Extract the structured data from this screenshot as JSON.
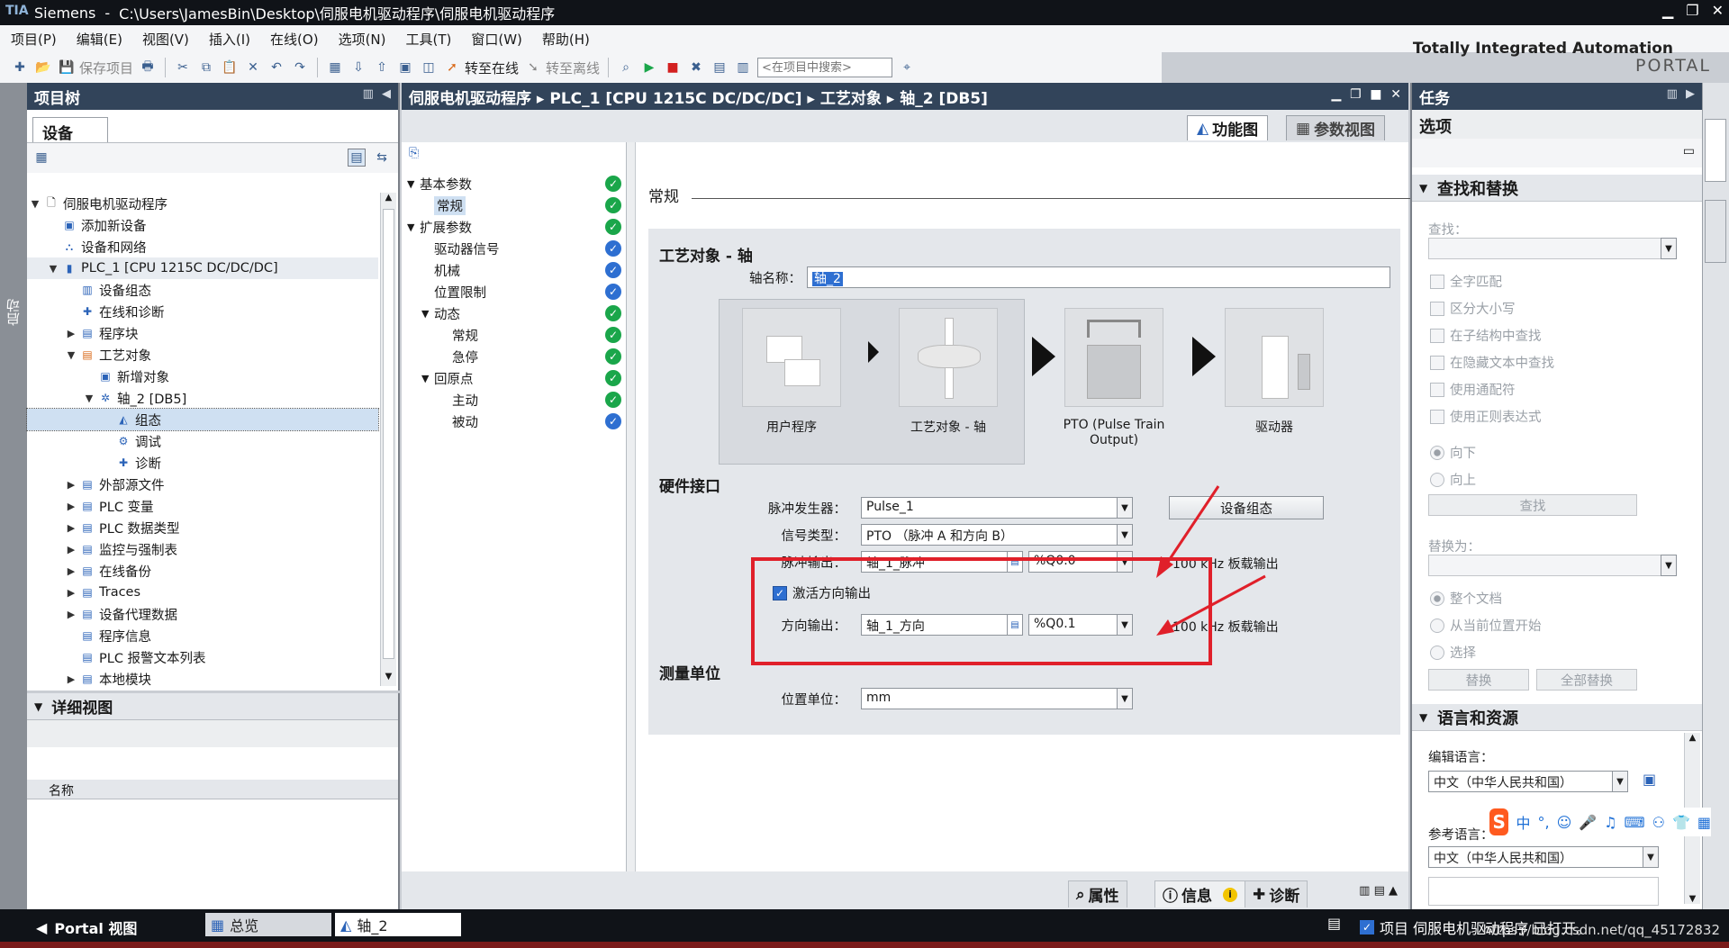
{
  "titlebar": {
    "app": "Siemens",
    "path": "C:\\Users\\JamesBin\\Desktop\\伺服电机驱动程序\\伺服电机驱动程序"
  },
  "menu": [
    "项目(P)",
    "编辑(E)",
    "视图(V)",
    "插入(I)",
    "在线(O)",
    "选项(N)",
    "工具(T)",
    "窗口(W)",
    "帮助(H)"
  ],
  "brand": {
    "line1": "Totally Integrated Automation",
    "line2": "PORTAL"
  },
  "toolbar": {
    "save_project": "保存项目",
    "go_online": "转至在线",
    "go_offline": "转至离线",
    "search_placeholder": "<在项目中搜索>"
  },
  "leftstrip": {
    "label": "启动"
  },
  "project_tree": {
    "title": "项目树",
    "tab": "设备",
    "items": [
      {
        "label": "伺服电机驱动程序",
        "icon": "project-icon"
      },
      {
        "label": "添加新设备",
        "icon": "add-device-icon"
      },
      {
        "label": "设备和网络",
        "icon": "network-icon"
      },
      {
        "label": "PLC_1 [CPU 1215C DC/DC/DC]",
        "icon": "plc-icon"
      },
      {
        "label": "设备组态",
        "icon": "device-config-icon"
      },
      {
        "label": "在线和诊断",
        "icon": "diagnostics-icon"
      },
      {
        "label": "程序块",
        "icon": "program-blocks-icon"
      },
      {
        "label": "工艺对象",
        "icon": "technology-objects-icon"
      },
      {
        "label": "新增对象",
        "icon": "add-object-icon"
      },
      {
        "label": "轴_2 [DB5]",
        "icon": "axis-icon"
      },
      {
        "label": "组态",
        "icon": "configuration-icon"
      },
      {
        "label": "调试",
        "icon": "commissioning-icon"
      },
      {
        "label": "诊断",
        "icon": "diagnostics-icon"
      },
      {
        "label": "外部源文件",
        "icon": "external-source-icon"
      },
      {
        "label": "PLC 变量",
        "icon": "plc-tags-icon"
      },
      {
        "label": "PLC 数据类型",
        "icon": "plc-datatypes-icon"
      },
      {
        "label": "监控与强制表",
        "icon": "watch-table-icon"
      },
      {
        "label": "在线备份",
        "icon": "online-backup-icon"
      },
      {
        "label": "Traces",
        "icon": "traces-icon"
      },
      {
        "label": "设备代理数据",
        "icon": "proxy-data-icon"
      },
      {
        "label": "程序信息",
        "icon": "program-info-icon"
      },
      {
        "label": "PLC 报警文本列表",
        "icon": "alarm-text-icon"
      },
      {
        "label": "本地模块",
        "icon": "local-modules-icon"
      }
    ]
  },
  "detail_view": {
    "title": "详细视图",
    "column": "名称"
  },
  "editor": {
    "breadcrumb": "伺服电机驱动程序 ▸ PLC_1 [CPU 1215C DC/DC/DC] ▸ 工艺对象 ▸ 轴_2 [DB5]",
    "tab_function": "功能图",
    "tab_param": "参数视图",
    "nav": [
      {
        "label": "基本参数",
        "status": "ok"
      },
      {
        "label": "常规",
        "status": "ok"
      },
      {
        "label": "扩展参数",
        "status": "ok"
      },
      {
        "label": "驱动器信号",
        "status": "info"
      },
      {
        "label": "机械",
        "status": "info"
      },
      {
        "label": "位置限制",
        "status": "info"
      },
      {
        "label": "动态",
        "status": "ok"
      },
      {
        "label": "常规",
        "status": "ok"
      },
      {
        "label": "急停",
        "status": "ok"
      },
      {
        "label": "回原点",
        "status": "ok"
      },
      {
        "label": "主动",
        "status": "ok"
      },
      {
        "label": "被动",
        "status": "info"
      }
    ],
    "section_general": "常规",
    "tech_object_title": "工艺对象 - 轴",
    "axis_name_label": "轴名称：",
    "axis_name_value": "轴_2",
    "flow": [
      "用户程序",
      "工艺对象 - 轴",
      "PTO (Pulse Train Output)",
      "驱动器"
    ],
    "hw_title": "硬件接口",
    "pulse_gen_label": "脉冲发生器：",
    "pulse_gen_value": "Pulse_1",
    "device_config_btn": "设备组态",
    "signal_type_label": "信号类型：",
    "signal_type_value": "PTO （脉冲 A 和方向 B）",
    "pulse_out_label": "脉冲输出：",
    "pulse_out_value": "轴_1_脉冲",
    "pulse_out_addr": "%Q0.0",
    "pulse_out_note": "100 kHz 板载输出",
    "enable_dir_label": "激活方向输出",
    "dir_out_label": "方向输出：",
    "dir_out_value": "轴_1_方向",
    "dir_out_addr": "%Q0.1",
    "dir_out_note": "100 kHz 板载输出",
    "unit_title": "测量单位",
    "pos_unit_label": "位置单位：",
    "pos_unit_value": "mm"
  },
  "editor_bottom": {
    "properties": "属性",
    "info": "信息",
    "diagnostics": "诊断"
  },
  "task_panel": {
    "title": "任务",
    "options": "选项",
    "find_replace": "查找和替换",
    "find_label": "查找：",
    "checks": [
      "全字匹配",
      "区分大小写",
      "在子结构中查找",
      "在隐藏文本中查找",
      "使用通配符",
      "使用正则表达式"
    ],
    "dir_down": "向下",
    "dir_up": "向上",
    "find_btn": "查找",
    "replace_label": "替换为：",
    "scope": [
      "整个文档",
      "从当前位置开始",
      "选择"
    ],
    "replace_btn": "替换",
    "replace_all_btn": "全部替换",
    "lang_title": "语言和资源",
    "edit_lang_label": "编辑语言：",
    "edit_lang_value": "中文（中华人民共和国）",
    "ref_lang_label": "参考语言：",
    "ref_lang_value": "中文（中华人民共和国）"
  },
  "ime": {
    "logo": "S",
    "mode": "中"
  },
  "statusbar": {
    "portal_view": "Portal 视图",
    "overview": "总览",
    "axis_tab": "轴_2",
    "message": "项目 伺服电机驱动程序 已打开。",
    "watermark": "https://blog.csdn.net/qq_45172832"
  },
  "colors": {
    "header_dark": "#32445a",
    "annotation_red": "#e0202a",
    "ok_green": "#1aa64a",
    "info_blue": "#2e6fd1"
  }
}
